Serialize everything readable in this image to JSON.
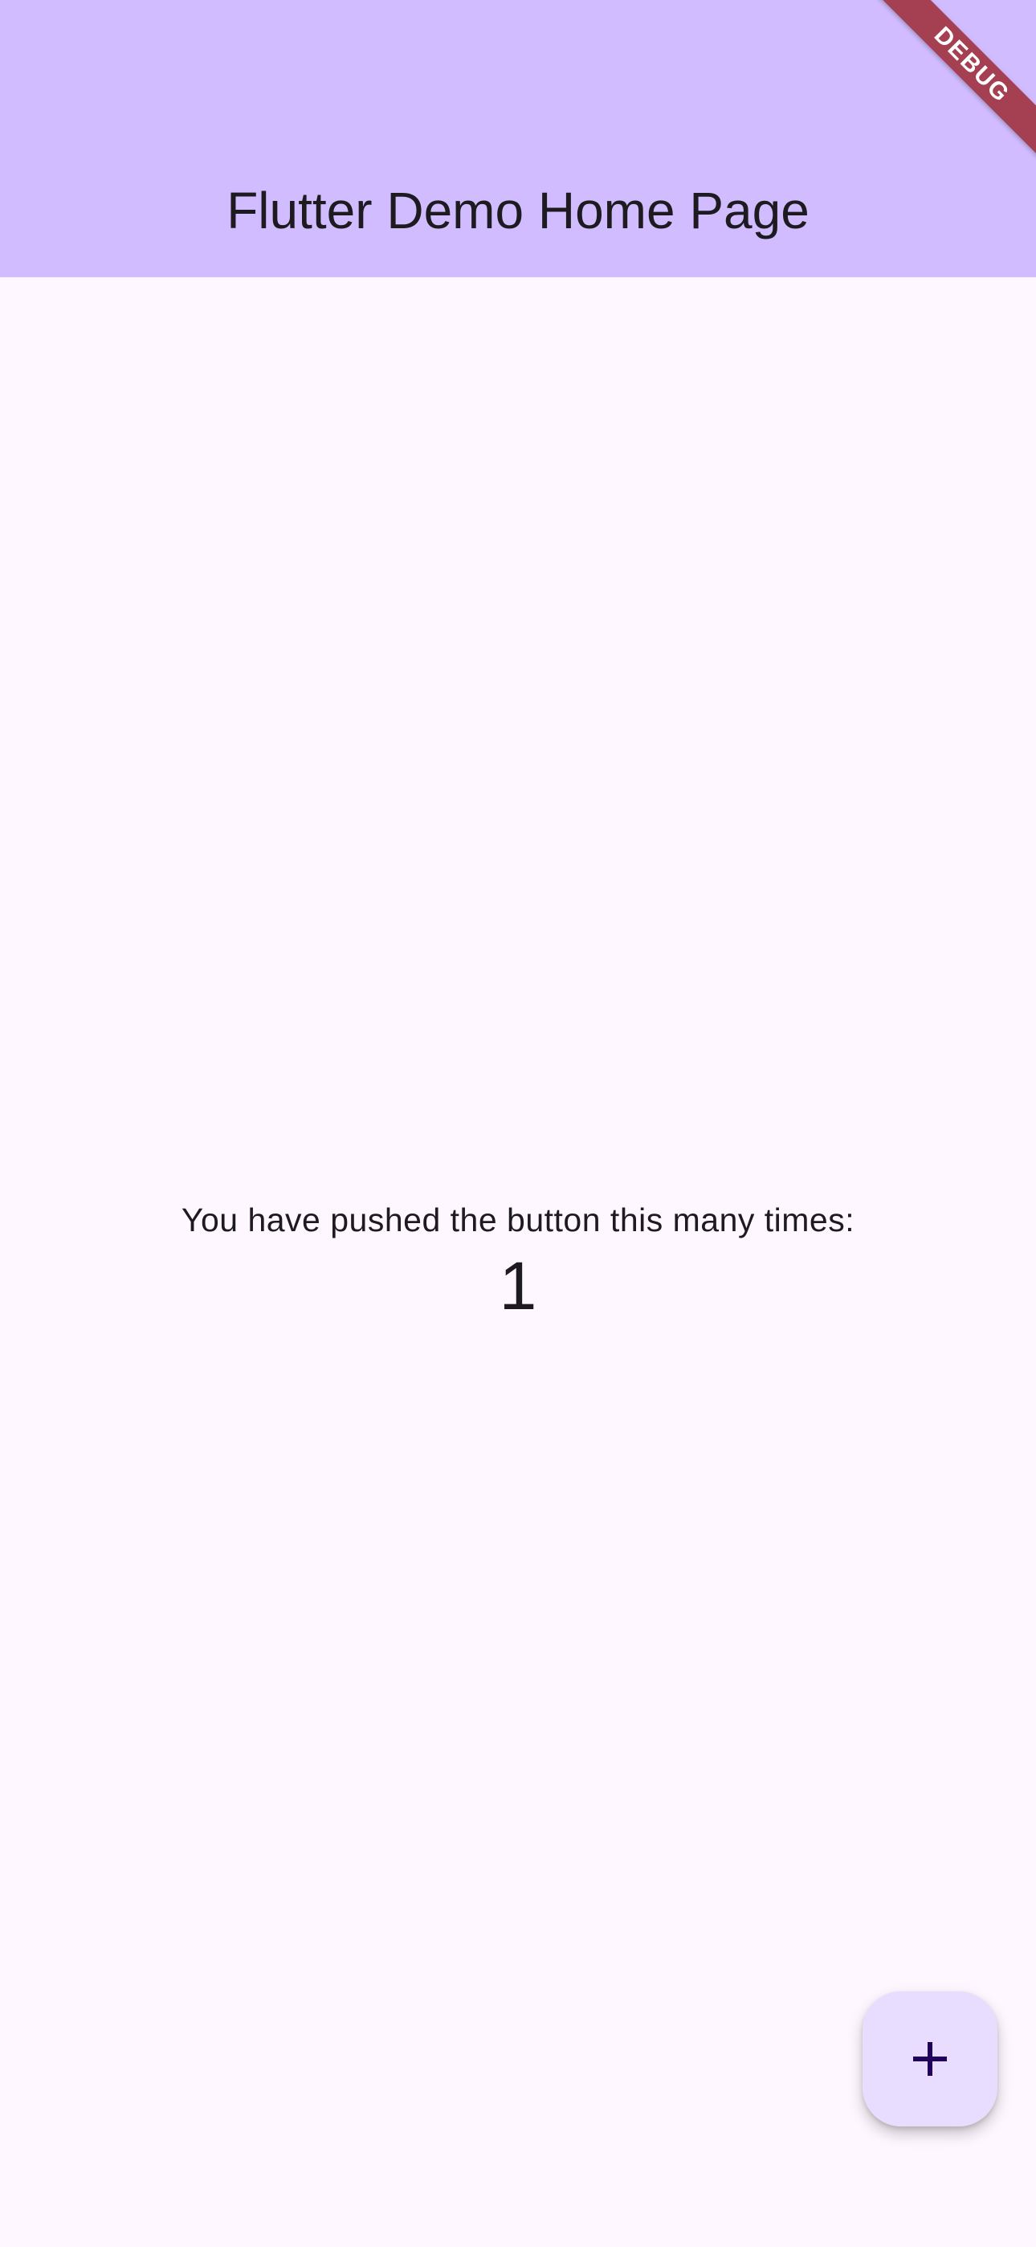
{
  "app_bar": {
    "title": "Flutter Demo Home Page"
  },
  "body": {
    "message": "You have pushed the button this many times:",
    "counter": "1"
  },
  "fab": {
    "icon": "add-icon"
  },
  "debug_banner": {
    "label": "DEBUG"
  },
  "colors": {
    "app_bar": "#d1bcff",
    "background": "#fef7ff",
    "fab": "#e9ddff",
    "fab_icon": "#21005d",
    "banner": "#a0313f"
  }
}
